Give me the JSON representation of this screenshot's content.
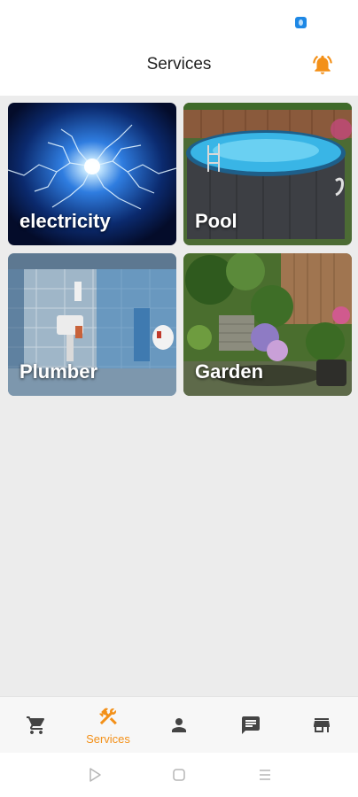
{
  "header": {
    "title": "Services"
  },
  "colors": {
    "accent": "#f39018",
    "background": "#ececec",
    "icon_inactive": "#444444"
  },
  "services": [
    {
      "label": "electricity",
      "image": "lightning-bolt-image"
    },
    {
      "label": "Pool",
      "image": "above-ground-pool-image"
    },
    {
      "label": "Plumber",
      "image": "bathroom-image"
    },
    {
      "label": "Garden",
      "image": "garden-patio-image"
    }
  ],
  "bottom_nav": {
    "items": [
      {
        "icon": "cart-icon",
        "label": ""
      },
      {
        "icon": "tools-icon",
        "label": "Services",
        "active": true
      },
      {
        "icon": "person-icon",
        "label": ""
      },
      {
        "icon": "chat-icon",
        "label": ""
      },
      {
        "icon": "store-icon",
        "label": ""
      }
    ]
  },
  "system_nav": {
    "buttons": [
      "back-icon",
      "home-icon",
      "menu-icon"
    ]
  }
}
